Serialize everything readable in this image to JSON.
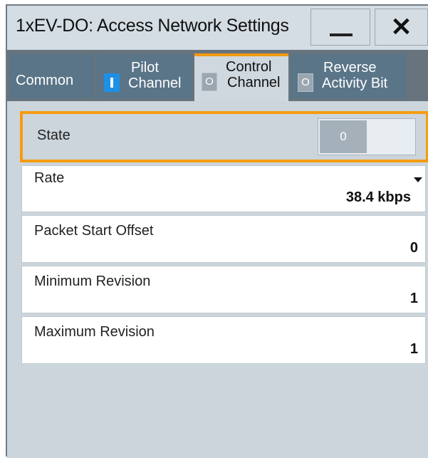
{
  "window": {
    "title": "1xEV-DO: Access Network Settings",
    "minimize_icon": "minimize-icon",
    "close_label": "✕"
  },
  "tabs": [
    {
      "label_line1": "Common",
      "label_line2": "",
      "indicator": null
    },
    {
      "label_line1": "Pilot",
      "label_line2": "Channel",
      "indicator": "on"
    },
    {
      "label_line1": "Control",
      "label_line2": "Channel",
      "indicator": "O",
      "active": true
    },
    {
      "label_line1": "Reverse",
      "label_line2": "Activity Bit",
      "indicator": "O"
    }
  ],
  "fields": {
    "state": {
      "label": "State",
      "toggle_value": "0"
    },
    "rate": {
      "label": "Rate",
      "value": "38.4 kbps"
    },
    "packet_start_offset": {
      "label": "Packet Start Offset",
      "value": "0"
    },
    "minimum_revision": {
      "label": "Minimum Revision",
      "value": "1"
    },
    "maximum_revision": {
      "label": "Maximum Revision",
      "value": "1"
    }
  },
  "colors": {
    "accent": "#f59c11",
    "indicator_on": "#1e90e6"
  }
}
